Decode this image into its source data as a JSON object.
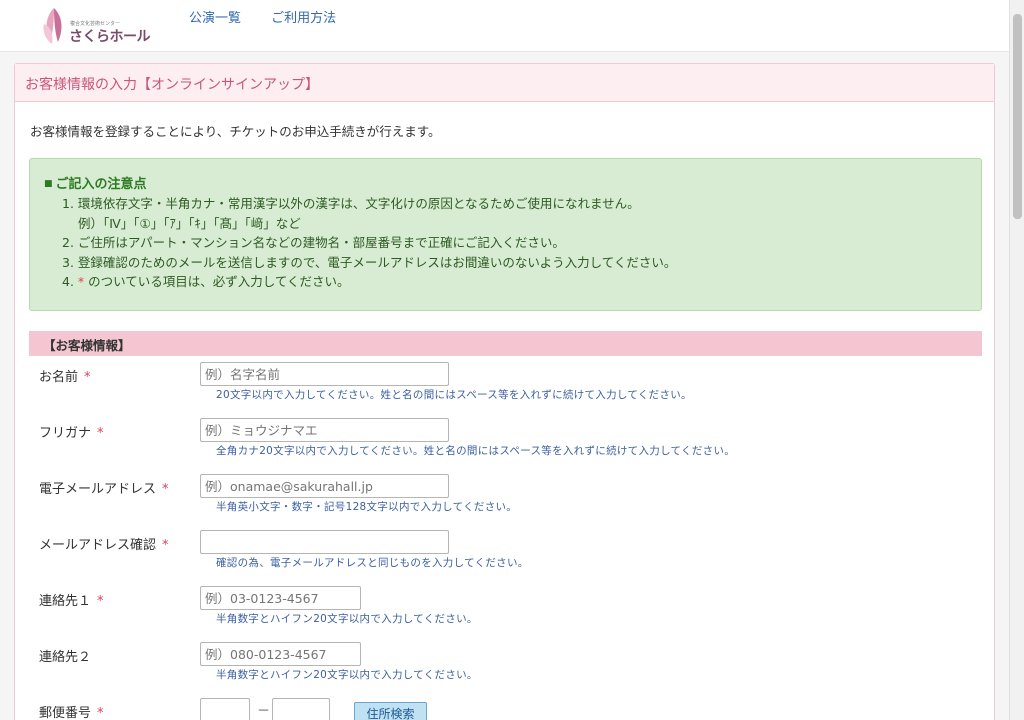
{
  "header": {
    "logo_sub": "複合文化芸術センター",
    "logo_name": "さくらホール",
    "nav": [
      "公演一覧",
      "ご利用方法"
    ]
  },
  "panel": {
    "title": "お客様情報の入力【オンラインサインアップ】",
    "intro": "お客様情報を登録することにより、チケットのお申込手続きが行えます。"
  },
  "notice": {
    "title": "ご記入の注意点",
    "items": [
      "1. 環境依存文字・半角カナ・常用漢字以外の漢字は、文字化けの原因となるためご使用になれません。",
      "例）「Ⅳ」「①」「ｱ」「ｷ」「髙」「﨑」など",
      "2. ご住所はアパート・マンション名などの建物名・部屋番号まで正確にご記入ください。",
      "3. 登録確認のためのメールを送信しますので、電子メールアドレスはお間違いのないよう入力してください。",
      "4. ",
      "のついている項目は、必ず入力してください。"
    ],
    "required_mark": "*"
  },
  "section": {
    "title": "【お客様情報】"
  },
  "form": {
    "name": {
      "label": "お名前",
      "placeholder": "例）名字名前",
      "help": "20文字以内で入力してください。姓と名の間にはスペース等を入れずに続けて入力してください。"
    },
    "kana": {
      "label": "フリガナ",
      "placeholder": "例）ミョウジナマエ",
      "help": "全角カナ20文字以内で入力してください。姓と名の間にはスペース等を入れずに続けて入力してください。"
    },
    "email": {
      "label": "電子メールアドレス",
      "placeholder": "例）onamae@sakurahall.jp",
      "help": "半角英小文字・数字・記号128文字以内で入力してください。"
    },
    "email_confirm": {
      "label": "メールアドレス確認",
      "placeholder": "",
      "help": "確認の為、電子メールアドレスと同じものを入力してください。"
    },
    "tel1": {
      "label": "連絡先１",
      "placeholder": "例）03-0123-4567",
      "help": "半角数字とハイフン20文字以内で入力してください。"
    },
    "tel2": {
      "label": "連絡先２",
      "placeholder": "例）080-0123-4567",
      "help": "半角数字とハイフン20文字以内で入力してください。"
    },
    "zip": {
      "label": "郵便番号",
      "separator": "－",
      "search_button": "住所検索"
    },
    "required_mark": "*"
  }
}
